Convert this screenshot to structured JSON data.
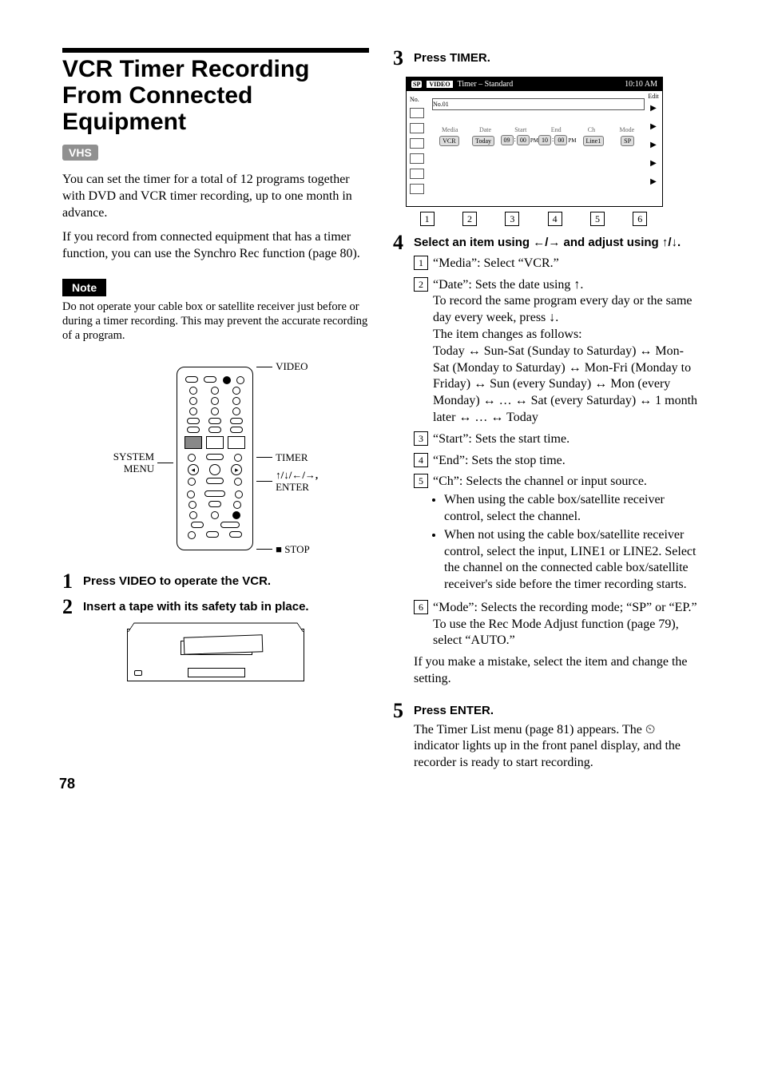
{
  "title": "VCR Timer Recording From Connected Equipment",
  "vhs_badge": "VHS",
  "intro": {
    "p1": "You can set the timer for a total of 12 programs together with DVD and VCR timer recording, up to one month in advance.",
    "p2": "If you record from connected equipment that has a timer function, you can use the Synchro Rec function (page 80)."
  },
  "note": {
    "label": "Note",
    "text": "Do not operate your cable box or satellite receiver just before or during a timer recording. This may prevent the accurate recording of a program."
  },
  "remote_labels": {
    "video": "VIDEO",
    "system_menu_l1": "SYSTEM",
    "system_menu_l2": "MENU",
    "timer": "TIMER",
    "arrows_enter_l1": "↑/↓/←/→,",
    "arrows_enter_l2": "ENTER",
    "stop": "■ STOP"
  },
  "steps": {
    "s1": {
      "num": "1",
      "head": "Press VIDEO to operate the VCR."
    },
    "s2": {
      "num": "2",
      "head": "Insert a tape with its safety tab in place."
    },
    "s3": {
      "num": "3",
      "head": "Press TIMER."
    },
    "s4": {
      "num": "4",
      "head": "Select an item using ←/→ and adjust using ↑/↓."
    },
    "s5": {
      "num": "5",
      "head": "Press ENTER."
    }
  },
  "screen": {
    "sp": "SP",
    "video": "VIDEO",
    "title": "Timer – Standard",
    "clock": "10:10 AM",
    "no_label": "No.",
    "no_first": "No.01",
    "edit_label": "Edit",
    "headers": {
      "media": "Media",
      "date": "Date",
      "start": "Start",
      "end": "End",
      "ch": "Ch",
      "mode": "Mode"
    },
    "row": {
      "media": "VCR",
      "date": "Today",
      "start_h": "09",
      "start_m": "00",
      "start_ap": "PM",
      "end_h": "10",
      "end_m": "00",
      "end_ap": "PM",
      "ch": "Line1",
      "mode": "SP"
    },
    "callouts": [
      "1",
      "2",
      "3",
      "4",
      "5",
      "6"
    ]
  },
  "s4_items": {
    "i1": {
      "n": "1",
      "text": "“Media”: Select “VCR.”"
    },
    "i2": {
      "n": "2",
      "line1": "“Date”: Sets the date using ↑.",
      "line2": "To record the same program every day or the same day every week, press ↓.",
      "line3": "The item changes as follows:",
      "line4": "Today ↔ Sun-Sat (Sunday to Saturday) ↔ Mon-Sat (Monday to Saturday) ↔ Mon-Fri (Monday to Friday) ↔ Sun (every Sunday) ↔ Mon (every Monday) ↔ … ↔ Sat (every Saturday) ↔ 1 month later ↔ … ↔ Today"
    },
    "i3": {
      "n": "3",
      "text": "“Start”: Sets the start time."
    },
    "i4": {
      "n": "4",
      "text": "“End”: Sets the stop time."
    },
    "i5": {
      "n": "5",
      "text": "“Ch”: Selects the channel or input source.",
      "b1": "When using the cable box/satellite receiver control, select the channel.",
      "b2": "When not using the cable box/satellite receiver control, select the input, LINE1 or LINE2. Select the channel on the connected cable box/satellite receiver's side before the timer recording starts."
    },
    "i6": {
      "n": "6",
      "text": "“Mode”: Selects the recording mode; “SP” or “EP.” To use the Rec Mode Adjust function (page 79), select “AUTO.”"
    },
    "tail": "If you make a mistake, select the item and change the setting."
  },
  "s5_body": "The Timer List menu (page 81) appears. The ⏲ indicator lights up in the front panel display, and the recorder is ready to start recording.",
  "page_number": "78"
}
